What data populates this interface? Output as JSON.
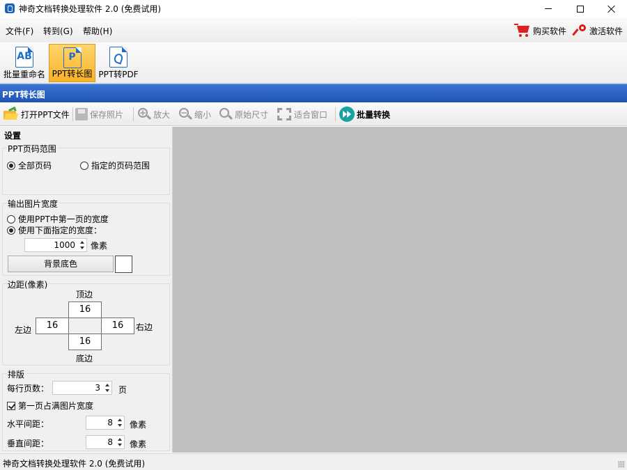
{
  "window": {
    "title": "神奇文档转换处理软件 2.0 (免费试用)"
  },
  "menu": {
    "file": "文件(F)",
    "goto": "转到(G)",
    "help": "帮助(H)",
    "buy": "购买软件",
    "activate": "激活软件"
  },
  "ribbon": {
    "items": [
      {
        "label": "批量重命名",
        "icon": "batch-rename-icon"
      },
      {
        "label": "PPT转长图",
        "icon": "ppt-icon",
        "active": true
      },
      {
        "label": "PPT转PDF",
        "icon": "pdf-icon"
      }
    ]
  },
  "section": {
    "title": "PPT转长图"
  },
  "toolbar": {
    "open": "打开PPT文件",
    "save": "保存照片",
    "zoom_in": "放大",
    "zoom_out": "缩小",
    "original": "原始尺寸",
    "fit": "适合窗口",
    "batch": "批量转换"
  },
  "settings": {
    "title": "设置",
    "range": {
      "title": "PPT页码范围",
      "all": "全部页码",
      "specified": "指定的页码范围",
      "selected": "all"
    },
    "width": {
      "title": "输出图片宽度",
      "option_first": "使用PPT中第一页的宽度",
      "option_custom": "使用下面指定的宽度：",
      "value": "1000",
      "unit": "像素",
      "bg_button": "背景底色",
      "bg_color": "#ffffff"
    },
    "margin": {
      "title": "边距(像素)",
      "top_label": "顶边",
      "bottom_label": "底边",
      "left_label": "左边",
      "right_label": "右边",
      "top": "16",
      "bottom": "16",
      "left": "16",
      "right": "16"
    },
    "layout": {
      "title": "排版",
      "per_row_label": "每行页数：",
      "per_row": "3",
      "per_row_unit": "页",
      "first_full": "第一页占满图片宽度",
      "h_gap_label": "水平间距：",
      "h_gap": "8",
      "v_gap_label": "垂直间距：",
      "v_gap": "8",
      "gap_unit": "像素"
    }
  },
  "status": {
    "text": "神奇文档转换处理软件 2.0 (免费试用)"
  },
  "colors": {
    "accent": "#1f54b6",
    "active_tab": "#f9b22a",
    "preview_bg": "#c0c0c0"
  }
}
